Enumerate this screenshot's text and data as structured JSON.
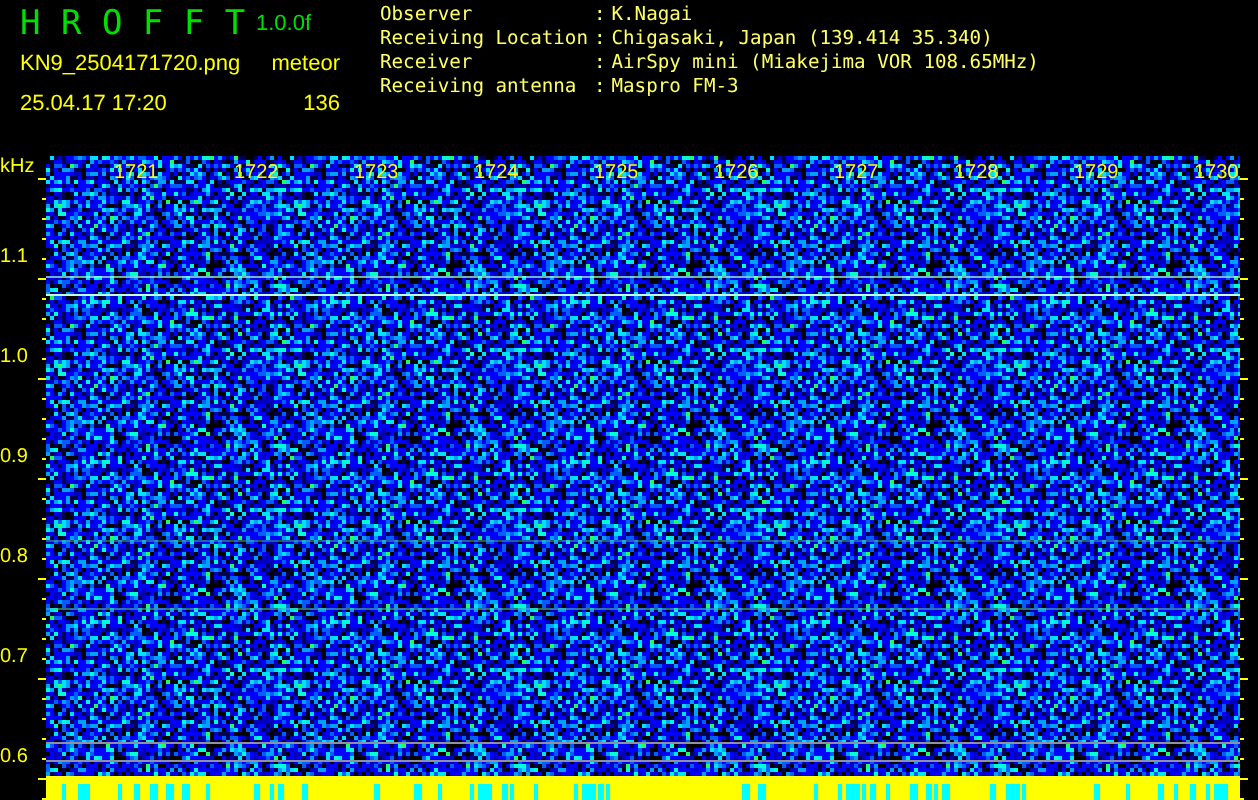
{
  "header": {
    "title": "H R O F F T",
    "version": "1.0.0f",
    "filename": "KN9_2504171720.png",
    "datetime": "25.04.17 17:20",
    "count_label": "meteor",
    "count": "136"
  },
  "info": [
    {
      "label": "Observer",
      "separator": ":",
      "value": "K.Nagai"
    },
    {
      "label": "Receiving Location",
      "separator": ":",
      "value": "Chigasaki, Japan (139.414 35.340)"
    },
    {
      "label": "Receiver",
      "separator": ":",
      "value": "AirSpy mini (Miakejima VOR 108.65MHz)"
    },
    {
      "label": "Receiving antenna",
      "separator": ":",
      "value": "Maspro FM-3"
    }
  ],
  "plot": {
    "unit": "kHz",
    "time_labels": [
      "1721",
      "1722",
      "1723",
      "1724",
      "1725",
      "1726",
      "1727",
      "1728",
      "1729",
      "1730"
    ],
    "freq_labels": [
      "1.1",
      "1.0",
      "0.9",
      "0.8",
      "0.7",
      "0.6"
    ]
  }
}
